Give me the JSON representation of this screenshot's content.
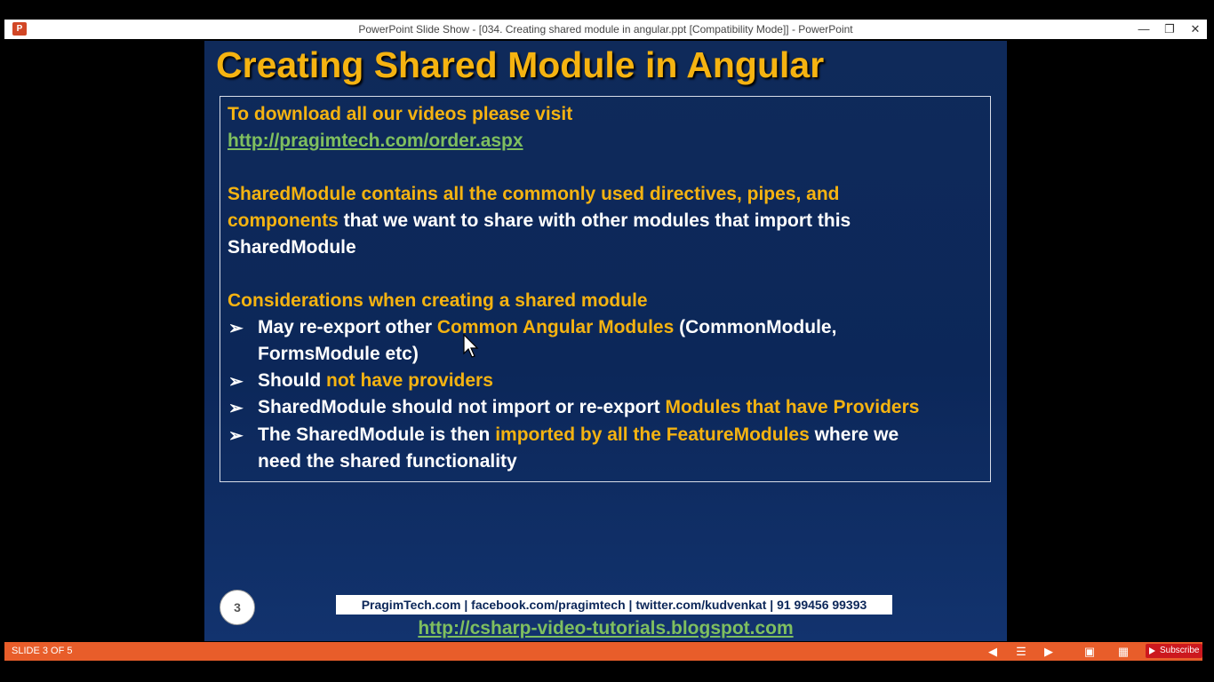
{
  "window": {
    "app_icon": "P",
    "title": "PowerPoint Slide Show - [034. Creating shared module in angular.ppt [Compatibility Mode]] - PowerPoint",
    "minimize": "—",
    "restore": "❐",
    "close": "✕"
  },
  "slide": {
    "title": "Creating Shared Module in Angular",
    "download_text": "To download all our videos please visit",
    "download_link": "http://pragimtech.com/order.aspx",
    "para1_line1": "SharedModule contains all the commonly used directives, pipes, and",
    "para1_line2_y": "components",
    "para1_line2_w": " that we want to share with other modules that import this",
    "para1_line3": "SharedModule",
    "considerations": "Considerations when creating a shared module",
    "bullet_arrow": "➢",
    "b1_a": "May re-export other ",
    "b1_b": "Common Angular Modules",
    "b1_c": " (CommonModule,",
    "b1_d": "FormsModule etc)",
    "b2_a": "Should ",
    "b2_b": "not have providers",
    "b3_a": "SharedModule should not import or re-export ",
    "b3_b": "Modules that have Providers",
    "b4_a": "The SharedModule is then ",
    "b4_b": "imported by all the FeatureModules",
    "b4_c": " where we",
    "b4_d": "need the shared functionality",
    "slide_number": "3",
    "footer_bar": "PragimTech.com | facebook.com/pragimtech | twitter.com/kudvenkat | 91 99456 99393",
    "footer_link": "http://csharp-video-tutorials.blogspot.com"
  },
  "status": {
    "slide_indicator": "SLIDE 3 OF 5",
    "prev_icon": "◀",
    "notes_icon": "☰",
    "next_icon": "▶",
    "normal_view_icon": "▣",
    "sorter_view_icon": "▦",
    "subscribe": "Subscribe"
  }
}
